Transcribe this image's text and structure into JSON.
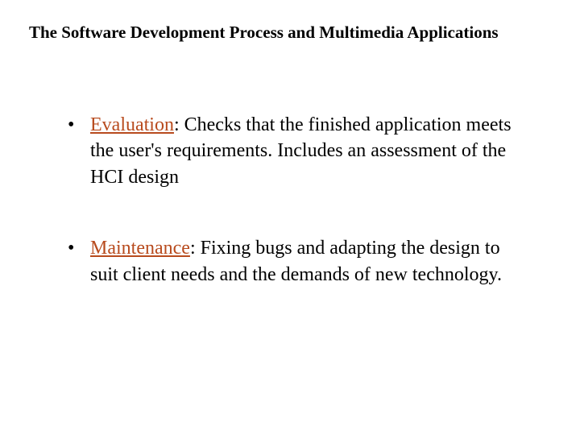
{
  "slide": {
    "title": "The Software Development Process and Multimedia Applications",
    "bullets": [
      {
        "term": "Evaluation",
        "text": ": Checks that the finished application meets the user's requirements. Includes an assessment of the HCI design"
      },
      {
        "term": "Maintenance",
        "text": ": Fixing bugs and adapting the design to suit client needs and the demands of new technology."
      }
    ]
  }
}
